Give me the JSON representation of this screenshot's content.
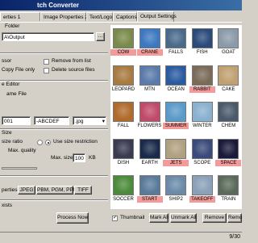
{
  "window": {
    "title": "tch Converter"
  },
  "tabs": [
    {
      "label": "erties 1"
    },
    {
      "label": "Image Properties 2"
    },
    {
      "label": "Text/Logo"
    },
    {
      "label": "Captions"
    },
    {
      "label": "Output Settings"
    }
  ],
  "left": {
    "output_folder_label": "Folder",
    "output_folder_value": "A\\Output",
    "browse_label": "...",
    "processor_label": "ssor",
    "copy_file_only": "Copy File only",
    "remove_from_list": "Remove from list",
    "delete_source_files": "Delete source files",
    "rename_group": "e Editor",
    "rename_file_label": "ame File",
    "rename_start": "001",
    "rename_pattern": "-ABCDEF",
    "rename_ext": ".jpg",
    "size_group": "Size",
    "size_ratio_label": "size ratio",
    "max_quality_label": "Max. quality",
    "use_size_restriction": "Use size restriction",
    "max_size_label": "Max. size:",
    "max_size_value": "100",
    "max_size_unit": "KB",
    "properties_label": "perties:",
    "fmt_jpeg": "JPEG",
    "fmt_pbm": "PBM, PGM, PPM",
    "fmt_tiff": "TIFF",
    "exists_label": "xists",
    "process_now": "Process Now"
  },
  "thumbnails": [
    {
      "caption": "COW",
      "selected": true,
      "color": "#7a8a4a"
    },
    {
      "caption": "CRANE",
      "selected": true,
      "color": "#3d78c0"
    },
    {
      "caption": "FALLS",
      "selected": false,
      "color": "#4a6a8a"
    },
    {
      "caption": "FISH",
      "selected": false,
      "color": "#2a4a7a"
    },
    {
      "caption": "GOAT",
      "selected": false,
      "color": "#8a9aa8"
    },
    {
      "caption": "LEOPARD",
      "selected": false,
      "color": "#a87a40"
    },
    {
      "caption": "MTN",
      "selected": false,
      "color": "#5a7aaa"
    },
    {
      "caption": "OCEAN",
      "selected": false,
      "color": "#2a5aa0"
    },
    {
      "caption": "RABBIT",
      "selected": true,
      "color": "#7a6a58"
    },
    {
      "caption": "CAKE",
      "selected": false,
      "color": "#c0a070"
    },
    {
      "caption": "FALL",
      "selected": false,
      "color": "#b06a2a"
    },
    {
      "caption": "FLOWERS",
      "selected": false,
      "color": "#c04a6a"
    },
    {
      "caption": "SUMMER",
      "selected": true,
      "color": "#5a9ac8"
    },
    {
      "caption": "WINTER",
      "selected": false,
      "color": "#8ab0d0"
    },
    {
      "caption": "CHEM",
      "selected": false,
      "color": "#4a5a6a"
    },
    {
      "caption": "DISH",
      "selected": false,
      "color": "#3a3a50"
    },
    {
      "caption": "EARTH",
      "selected": false,
      "color": "#1a2a4a"
    },
    {
      "caption": "JETS",
      "selected": true,
      "color": "#b0a080"
    },
    {
      "caption": "SCOPE",
      "selected": false,
      "color": "#3a4a7a"
    },
    {
      "caption": "SPACE",
      "selected": true,
      "color": "#1a1a3a"
    },
    {
      "caption": "SOCCER",
      "selected": false,
      "color": "#4a8a3a"
    },
    {
      "caption": "START",
      "selected": true,
      "color": "#5a7a9a"
    },
    {
      "caption": "SHIP2",
      "selected": false,
      "color": "#6a8aa8"
    },
    {
      "caption": "TAKEOFF",
      "selected": true,
      "color": "#8aa0b8"
    },
    {
      "caption": "TRAIN",
      "selected": false,
      "color": "#5a6a5a"
    }
  ],
  "bottom": {
    "thumbnail_label": "Thumbnail",
    "mark_all": "Mark All",
    "unmark_all": "Unmark All",
    "remove": "Remove",
    "reload": "Remo"
  },
  "status": {
    "count": "9/30"
  }
}
